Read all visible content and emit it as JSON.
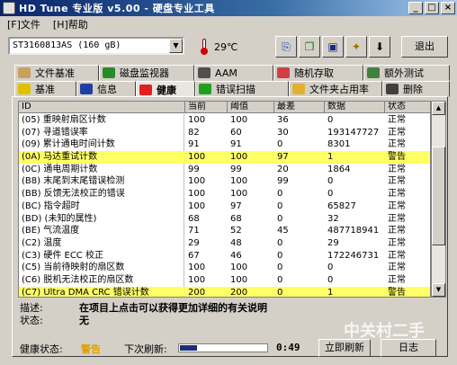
{
  "window": {
    "title": "HD Tune 专业版 v5.00 - 硬盘专业工具"
  },
  "menu": [
    "[F]文件",
    "[H]帮助"
  ],
  "toolbar": {
    "drive": "ST3160813AS (160 gB)",
    "temperature": "29℃",
    "exit_label": "退出",
    "icons": [
      "copy-info-icon",
      "copy-screen-icon",
      "save-icon",
      "settings-icon",
      "download-icon"
    ]
  },
  "tabs": {
    "top": [
      {
        "label": "文件基准",
        "icon": "file-benchmark-icon",
        "color": "#c8a060"
      },
      {
        "label": "磁盘监视器",
        "icon": "disk-monitor-icon",
        "color": "#2a8a2a"
      },
      {
        "label": "AAM",
        "icon": "speaker-icon",
        "color": "#505050"
      },
      {
        "label": "随机存取",
        "icon": "random-access-icon",
        "color": "#d04040"
      },
      {
        "label": "额外测试",
        "icon": "extra-tests-icon",
        "color": "#408040"
      }
    ],
    "bottom": [
      {
        "label": "基准",
        "icon": "benchmark-icon",
        "color": "#e0c000"
      },
      {
        "label": "信息",
        "icon": "info-icon",
        "color": "#2040a0"
      },
      {
        "label": "健康",
        "icon": "health-cross-icon",
        "color": "#e02020",
        "active": true
      },
      {
        "label": "错误扫描",
        "icon": "magnifier-icon",
        "color": "#20a020"
      },
      {
        "label": "文件夹占用率",
        "icon": "folder-icon",
        "color": "#e0b030"
      },
      {
        "label": "删除",
        "icon": "erase-icon",
        "color": "#404040"
      }
    ]
  },
  "table": {
    "headers": [
      "ID",
      "当前",
      "阈值",
      "最差",
      "数据",
      "状态"
    ],
    "rows": [
      {
        "id": "(05) 重映射扇区计数",
        "cur": "100",
        "thr": "100",
        "worst": "36",
        "data": "0",
        "status": "正常"
      },
      {
        "id": "(07) 寻道错误率",
        "cur": "82",
        "thr": "60",
        "worst": "30",
        "data": "193147727",
        "status": "正常"
      },
      {
        "id": "(09) 累计通电时间计数",
        "cur": "91",
        "thr": "91",
        "worst": "0",
        "data": "8301",
        "status": "正常"
      },
      {
        "id": "(0A) 马达重试计数",
        "cur": "100",
        "thr": "100",
        "worst": "97",
        "data": "1",
        "status": "警告",
        "warn": true
      },
      {
        "id": "(0C) 通电周期计数",
        "cur": "99",
        "thr": "99",
        "worst": "20",
        "data": "1864",
        "status": "正常"
      },
      {
        "id": "(B8) 末尾到末尾错误检测",
        "cur": "100",
        "thr": "100",
        "worst": "99",
        "data": "0",
        "status": "正常"
      },
      {
        "id": "(BB) 反馈无法校正的错误",
        "cur": "100",
        "thr": "100",
        "worst": "0",
        "data": "0",
        "status": "正常"
      },
      {
        "id": "(BC) 指令超时",
        "cur": "100",
        "thr": "97",
        "worst": "0",
        "data": "65827",
        "status": "正常"
      },
      {
        "id": "(BD) (未知的属性)",
        "cur": "68",
        "thr": "68",
        "worst": "0",
        "data": "32",
        "status": "正常"
      },
      {
        "id": "(BE) 气流温度",
        "cur": "71",
        "thr": "52",
        "worst": "45",
        "data": "487718941",
        "status": "正常"
      },
      {
        "id": "(C2) 温度",
        "cur": "29",
        "thr": "48",
        "worst": "0",
        "data": "29",
        "status": "正常"
      },
      {
        "id": "(C3) 硬件 ECC 校正",
        "cur": "67",
        "thr": "46",
        "worst": "0",
        "data": "172246731",
        "status": "正常"
      },
      {
        "id": "(C5) 当前待映射的扇区数",
        "cur": "100",
        "thr": "100",
        "worst": "0",
        "data": "0",
        "status": "正常"
      },
      {
        "id": "(C6) 脱机无法校正的扇区数",
        "cur": "100",
        "thr": "100",
        "worst": "0",
        "data": "0",
        "status": "正常"
      },
      {
        "id": "(C7) Ultra DMA CRC 错误计数",
        "cur": "200",
        "thr": "200",
        "worst": "0",
        "data": "1",
        "status": "警告",
        "warn": true
      }
    ]
  },
  "details": {
    "desc_label": "描述:",
    "desc_value": "在项目上点击可以获得更加详细的有关说明",
    "state_label": "状态:",
    "state_value": "无"
  },
  "statusbar": {
    "health_label": "健康状态:",
    "health_value": "警告",
    "refresh_label": "下次刷新:",
    "refresh_progress": 0.2,
    "countdown": "0:49",
    "refresh_button": "立即刷新",
    "log_button": "日志"
  },
  "watermark": "中关村二手",
  "colors": {
    "warning_row": "#ffff66",
    "health_warning": "#e0a000",
    "titlebar": "#0a246a"
  }
}
